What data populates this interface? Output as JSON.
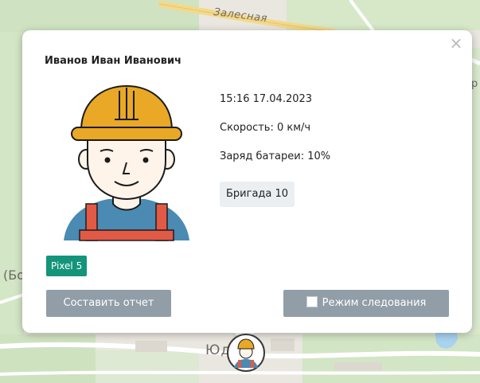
{
  "map": {
    "street_label": "Залесная",
    "district_label": "Юди",
    "left_label": "(Бо",
    "right_label": "р"
  },
  "popup": {
    "close_symbol": "×",
    "name": "Иванов Иван Иванович",
    "timestamp": "15:16 17.04.2023",
    "speed": "Скорость: 0 км/ч",
    "battery": "Заряд батареи: 10%",
    "team": "Бригада 10",
    "device": "Pixel 5",
    "report_button": "Составить отчет",
    "follow_button": "Режим следования",
    "follow_checked": false,
    "avatar_icon": "worker-avatar-icon"
  },
  "colors": {
    "device_badge": "#14947a",
    "button": "#919ea8",
    "team_badge_bg": "#eceff2",
    "helmet": "#e9a826",
    "overalls": "#e25a45",
    "shirt": "#4a8ab3"
  }
}
